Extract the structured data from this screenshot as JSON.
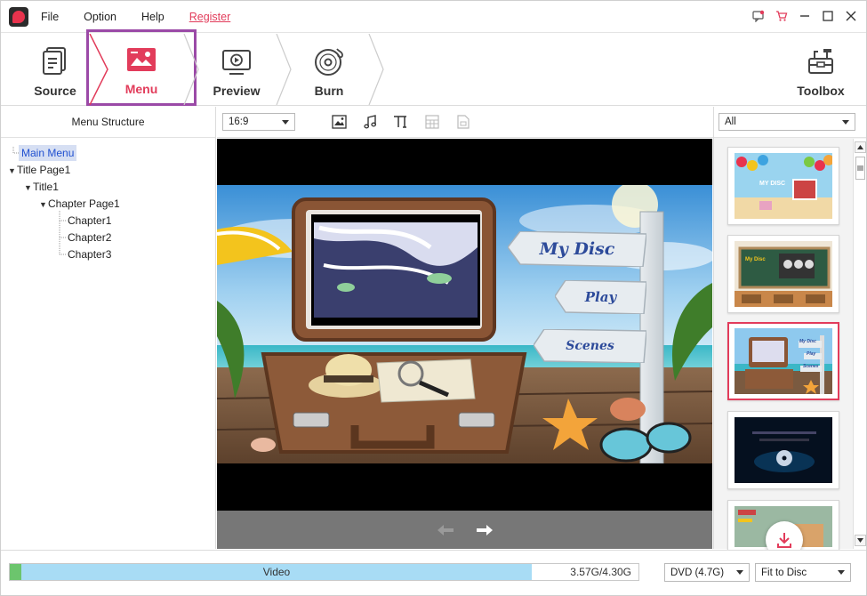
{
  "menubar": {
    "file": "File",
    "option": "Option",
    "help": "Help",
    "register": "Register"
  },
  "steps": {
    "source": "Source",
    "menu": "Menu",
    "preview": "Preview",
    "burn": "Burn",
    "toolbox": "Toolbox"
  },
  "left_panel": {
    "title": "Menu Structure",
    "tree": [
      {
        "label": "Main Menu",
        "level": 0,
        "selected": true,
        "expander": ""
      },
      {
        "label": "Title Page1",
        "level": 0,
        "selected": false,
        "expander": "▼"
      },
      {
        "label": "Title1",
        "level": 1,
        "selected": false,
        "expander": "▼"
      },
      {
        "label": "Chapter Page1",
        "level": 2,
        "selected": false,
        "expander": "▼"
      },
      {
        "label": "Chapter1",
        "level": 3,
        "selected": false,
        "expander": ""
      },
      {
        "label": "Chapter2",
        "level": 3,
        "selected": false,
        "expander": ""
      },
      {
        "label": "Chapter3",
        "level": 3,
        "selected": false,
        "expander": ""
      }
    ]
  },
  "editor": {
    "aspect_ratio": "16:9",
    "tools": [
      "image-icon",
      "music-icon",
      "text-icon",
      "grid-icon",
      "page-icon"
    ]
  },
  "preview_menu": {
    "btn1": "My Disc",
    "btn2": "Play",
    "btn3": "Scenes"
  },
  "templates": {
    "filter": "All",
    "items": [
      {
        "name": "party-template",
        "selected": false
      },
      {
        "name": "classroom-template",
        "selected": false
      },
      {
        "name": "beach-template",
        "selected": true
      },
      {
        "name": "dark-disc-template",
        "selected": false
      },
      {
        "name": "partial-template",
        "selected": false
      }
    ],
    "mini_labels": {
      "mydisc": "My Disc",
      "play": "Play",
      "scenes": "Scenes"
    }
  },
  "bottom": {
    "progress_label": "Video",
    "size_text": "3.57G/4.30G",
    "used_fraction": 0.83,
    "disc_type": "DVD (4.7G)",
    "fit_mode": "Fit to Disc"
  },
  "colors": {
    "accent": "#e23c5b",
    "highlight_frame": "#9b4aa7",
    "progress_fill": "#a8dcf5"
  }
}
